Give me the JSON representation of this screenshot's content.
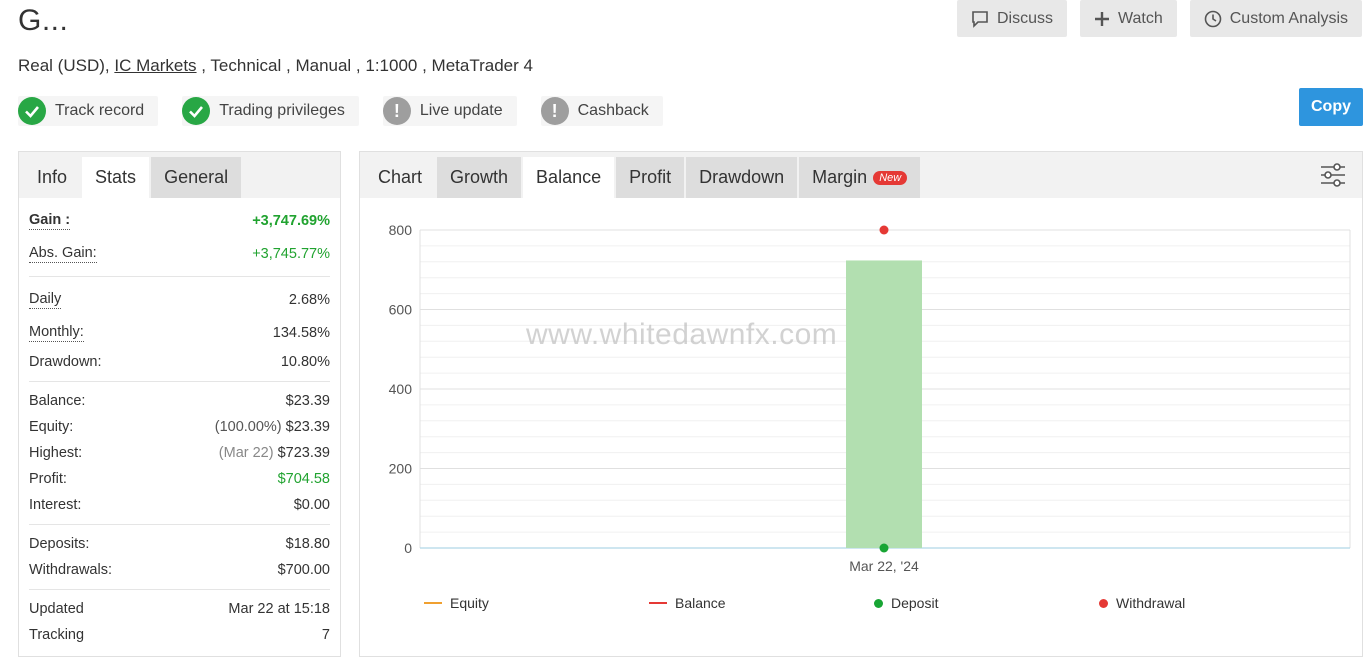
{
  "header": {
    "title": "G...",
    "actions": [
      {
        "label": "Discuss",
        "icon": "comment-icon"
      },
      {
        "label": "Watch",
        "icon": "plus-icon"
      },
      {
        "label": "Custom Analysis",
        "icon": "clock-icon"
      }
    ]
  },
  "account": {
    "prefix": "Real (USD), ",
    "broker": "IC Markets",
    "rest": " , Technical , Manual , 1:1000 , MetaTrader 4"
  },
  "badges": [
    {
      "label": "Track record",
      "status": "verified",
      "icon": "check-icon"
    },
    {
      "label": "Trading privileges",
      "status": "verified",
      "icon": "check-icon"
    },
    {
      "label": "Live update",
      "status": "unverified",
      "icon": "exclamation-icon"
    },
    {
      "label": "Cashback",
      "status": "unverified",
      "icon": "exclamation-icon"
    }
  ],
  "copy_button": "Copy",
  "left_tabs": [
    "Info",
    "Stats",
    "General"
  ],
  "stats": {
    "gain": {
      "label": "Gain :",
      "value": "+3,747.69%"
    },
    "abs_gain": {
      "label": "Abs. Gain:",
      "value": "+3,745.77%"
    },
    "daily": {
      "label": "Daily",
      "value": "2.68%"
    },
    "monthly": {
      "label": "Monthly:",
      "value": "134.58%"
    },
    "drawdown": {
      "label": "Drawdown:",
      "value": "10.80%"
    },
    "balance": {
      "label": "Balance:",
      "value": "$23.39"
    },
    "equity": {
      "label": "Equity:",
      "note": "(100.00%)",
      "value": "$23.39"
    },
    "highest": {
      "label": "Highest:",
      "note": "(Mar 22)",
      "value": "$723.39"
    },
    "profit": {
      "label": "Profit:",
      "value": "$704.58"
    },
    "interest": {
      "label": "Interest:",
      "value": "$0.00"
    },
    "deposits": {
      "label": "Deposits:",
      "value": "$18.80"
    },
    "withdrawals": {
      "label": "Withdrawals:",
      "value": "$700.00"
    },
    "updated": {
      "label": "Updated",
      "value": "Mar 22 at 15:18"
    },
    "tracking": {
      "label": "Tracking",
      "value": "7"
    }
  },
  "chart_tabs": {
    "chart": "Chart",
    "growth": "Growth",
    "balance": "Balance",
    "profit": "Profit",
    "drawdown": "Drawdown",
    "margin": "Margin",
    "new_badge": "New"
  },
  "watermark": "www.whitedawnfx.com",
  "colors": {
    "gain_green": "#21a330",
    "copy_blue": "#2e95de",
    "bar_green": "#b2dfb0",
    "equity_line": "#f0a030",
    "balance_line": "#e53935",
    "deposit_dot": "#18a534",
    "withdrawal_dot": "#e53935"
  },
  "chart_data": {
    "type": "bar",
    "categories": [
      "Mar 22, '24"
    ],
    "values": [
      723.39
    ],
    "ylim": [
      0,
      800
    ],
    "yticks": [
      0,
      200,
      400,
      600,
      800
    ],
    "deposits": [
      {
        "x": "Mar 22, '24",
        "y": 0
      }
    ],
    "withdrawals": [
      {
        "x": "Mar 22, '24",
        "y": 800
      }
    ],
    "legend": [
      "Equity",
      "Balance",
      "Deposit",
      "Withdrawal"
    ],
    "legend_position": "bottom",
    "grid": true
  }
}
